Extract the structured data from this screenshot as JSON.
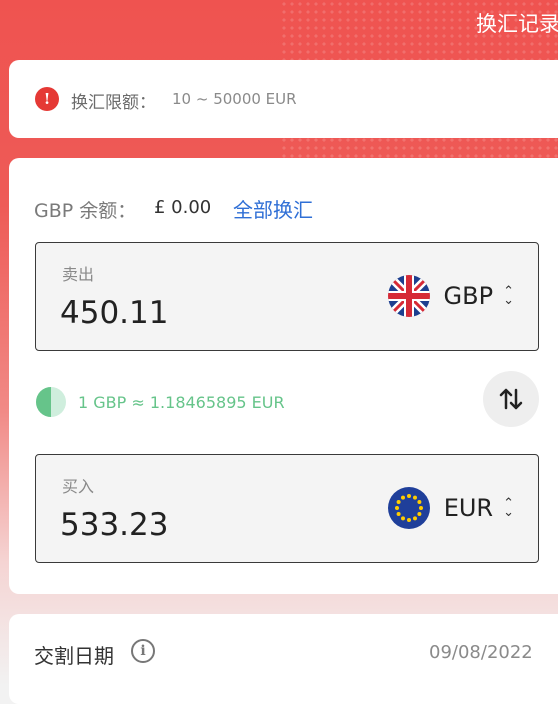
{
  "header": {
    "records_link": "换汇记录"
  },
  "limit": {
    "label": "换汇限额：",
    "value": "10 ~ 50000 EUR"
  },
  "balance": {
    "label": "GBP 余额：",
    "value": "£ 0.00",
    "convert_all": "全部换汇"
  },
  "sell": {
    "label": "卖出",
    "amount": "450.11",
    "currency": "GBP",
    "flag_icon": "uk-flag-icon"
  },
  "rate": {
    "text": "1 GBP ≈ 1.18465895 EUR",
    "icon": "rate-timer-icon"
  },
  "swap": {
    "icon": "swap-arrows-icon"
  },
  "buy": {
    "label": "买入",
    "amount": "533.23",
    "currency": "EUR",
    "flag_icon": "eu-flag-icon"
  },
  "settlement": {
    "label": "交割日期",
    "date": "09/08/2022"
  },
  "colors": {
    "brand_red": "#ef5350",
    "link_blue": "#2f6fd6",
    "rate_green": "#66c48a"
  }
}
